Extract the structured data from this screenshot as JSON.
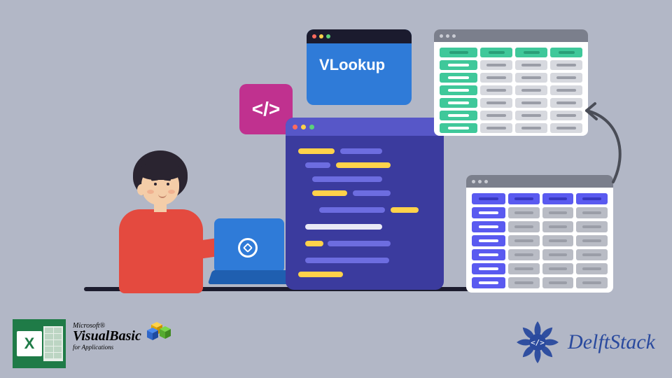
{
  "vlookup": {
    "label": "VLookup"
  },
  "code_tile": {
    "glyph": "</>"
  },
  "logos": {
    "excel_letter": "X",
    "vb_ms": "Microsoft®",
    "vb_main_1": "Visual",
    "vb_main_2": "Basic",
    "vb_sub": "for Applications",
    "delft": "DelftStack"
  },
  "icons": {
    "traffic_red": "red",
    "traffic_yellow": "yellow",
    "traffic_green": "green"
  }
}
